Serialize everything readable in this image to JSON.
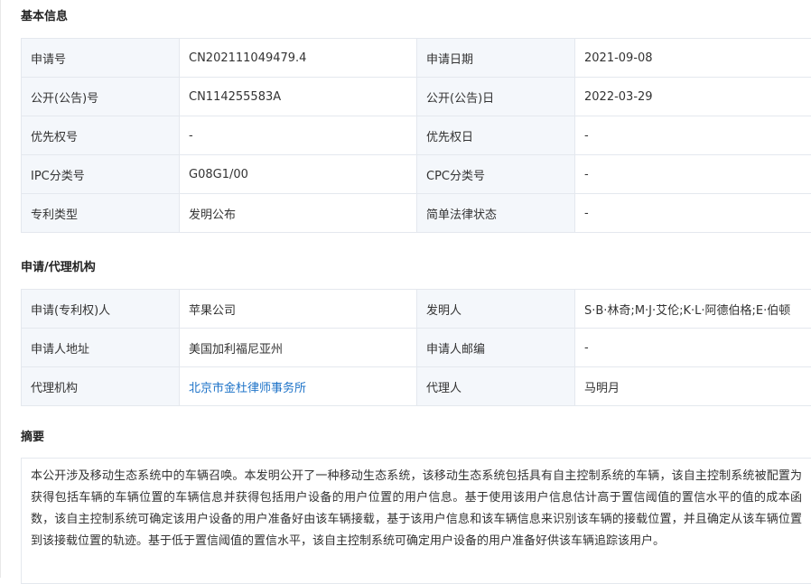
{
  "basic_info": {
    "title": "基本信息",
    "rows": [
      [
        {
          "label": "申请号",
          "value": "CN202111049479.4"
        },
        {
          "label": "申请日期",
          "value": "2021-09-08"
        }
      ],
      [
        {
          "label": "公开(公告)号",
          "value": "CN114255583A"
        },
        {
          "label": "公开(公告)日",
          "value": "2022-03-29"
        }
      ],
      [
        {
          "label": "优先权号",
          "value": "-"
        },
        {
          "label": "优先权日",
          "value": "-"
        }
      ],
      [
        {
          "label": "IPC分类号",
          "value": "G08G1/00"
        },
        {
          "label": "CPC分类号",
          "value": "-"
        }
      ],
      [
        {
          "label": "专利类型",
          "value": "发明公布"
        },
        {
          "label": "简单法律状态",
          "value": "-"
        }
      ]
    ]
  },
  "agency_info": {
    "title": "申请/代理机构",
    "rows": [
      [
        {
          "label": "申请(专利权)人",
          "value": "苹果公司"
        },
        {
          "label": "发明人",
          "value": "S·B·林奇;M·J·艾伦;K·L·阿德伯格;E·伯顿"
        }
      ],
      [
        {
          "label": "申请人地址",
          "value": "美国加利福尼亚州"
        },
        {
          "label": "申请人邮编",
          "value": "-"
        }
      ],
      [
        {
          "label": "代理机构",
          "value": "北京市金杜律师事务所"
        },
        {
          "label": "代理人",
          "value": "马明月"
        }
      ]
    ]
  },
  "abstract": {
    "title": "摘要",
    "text": "本公开涉及移动生态系统中的车辆召唤。本发明公开了一种移动生态系统，该移动生态系统包括具有自主控制系统的车辆，该自主控制系统被配置为获得包括车辆的车辆位置的车辆信息并获得包括用户设备的用户位置的用户信息。基于使用该用户信息估计高于置信阈值的置信水平的值的成本函数，该自主控制系统可确定该用户设备的用户准备好由该车辆接载，基于该用户信息和该车辆信息来识别该车辆的接载位置，并且确定从该车辆位置到该接载位置的轨迹。基于低于置信阈值的置信水平，该自主控制系统可确定用户设备的用户准备好供该车辆追踪该用户。"
  }
}
